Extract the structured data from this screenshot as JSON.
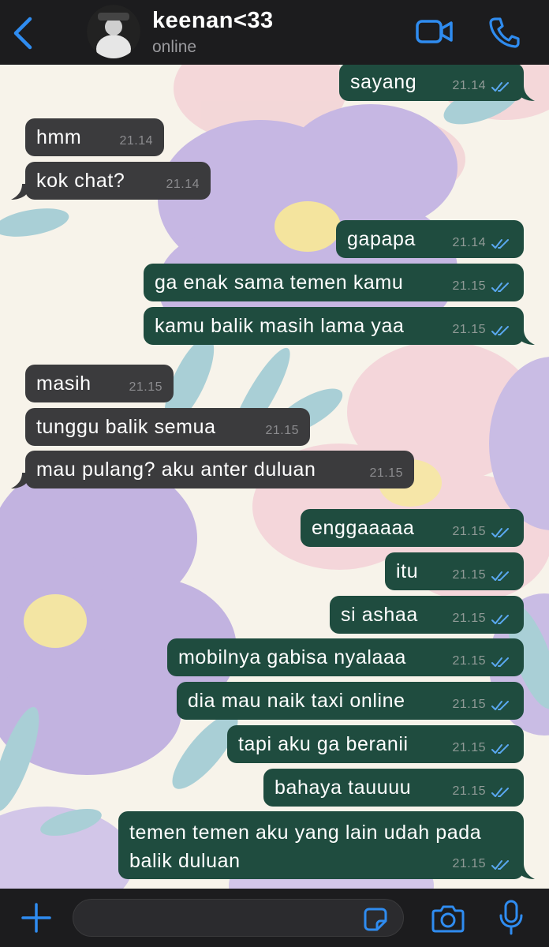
{
  "header": {
    "contact_name": "keenan<33",
    "status": "online"
  },
  "messages": [
    {
      "dir": "out",
      "text": "sayang",
      "time": "21.14"
    },
    {
      "dir": "in",
      "text": "hmm",
      "time": "21.14"
    },
    {
      "dir": "in",
      "text": "kok chat?",
      "time": "21.14"
    },
    {
      "dir": "out",
      "text": "gapapa",
      "time": "21.14"
    },
    {
      "dir": "out",
      "text": "ga enak sama temen kamu",
      "time": "21.15"
    },
    {
      "dir": "out",
      "text": "kamu balik masih lama yaa",
      "time": "21.15"
    },
    {
      "dir": "in",
      "text": "masih",
      "time": "21.15"
    },
    {
      "dir": "in",
      "text": "tunggu balik semua",
      "time": "21.15"
    },
    {
      "dir": "in",
      "text": "mau pulang? aku anter duluan",
      "time": "21.15"
    },
    {
      "dir": "out",
      "text": "enggaaaaa",
      "time": "21.15"
    },
    {
      "dir": "out",
      "text": "itu",
      "time": "21.15"
    },
    {
      "dir": "out",
      "text": "si ashaa",
      "time": "21.15"
    },
    {
      "dir": "out",
      "text": "mobilnya gabisa nyalaaa",
      "time": "21.15"
    },
    {
      "dir": "out",
      "text": "dia mau naik taxi online",
      "time": "21.15"
    },
    {
      "dir": "out",
      "text": "tapi aku ga beranii",
      "time": "21.15"
    },
    {
      "dir": "out",
      "text": "bahaya tauuuu",
      "time": "21.15"
    },
    {
      "dir": "out",
      "text_line1": "temen temen aku yang lain udah pada",
      "text_line2": "balik duluan",
      "time": "21.15"
    }
  ],
  "composer": {
    "input_value": ""
  },
  "colors": {
    "accent": "#2f8cf0",
    "bubble_out": "#1f4c3f",
    "bubble_in": "#3b3b3d",
    "header_bg": "#1c1c1e",
    "read_ticks": "#5aa8f0"
  },
  "icons": {
    "back": "chevron-left-icon",
    "video": "video-camera-icon",
    "call": "phone-icon",
    "add": "plus-icon",
    "sticker": "sticker-icon",
    "camera": "camera-icon",
    "mic": "microphone-icon"
  }
}
